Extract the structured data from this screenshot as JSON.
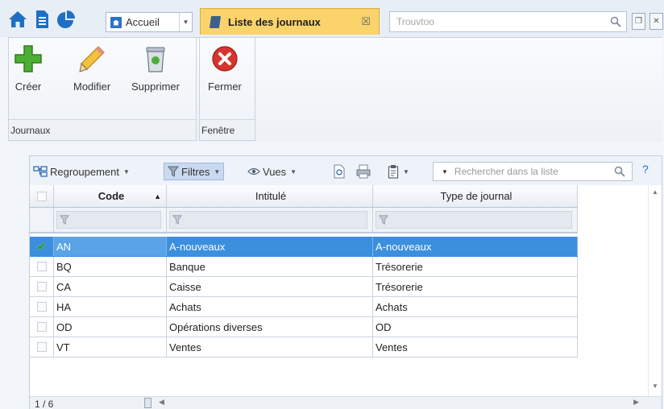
{
  "topbar": {
    "home_tab": {
      "label": "Accueil"
    },
    "active_tab": {
      "label": "Liste des journaux",
      "close_glyph": "☒"
    },
    "search": {
      "placeholder": "Trouvtoo"
    }
  },
  "ribbon": {
    "groups": [
      {
        "label": "Journaux",
        "buttons": [
          {
            "label": "Créer",
            "icon": "add-icon"
          },
          {
            "label": "Modifier",
            "icon": "pencil-icon"
          },
          {
            "label": "Supprimer",
            "icon": "trash-icon"
          }
        ]
      },
      {
        "label": "Fenêtre",
        "buttons": [
          {
            "label": "Fermer",
            "icon": "close-icon"
          }
        ]
      }
    ]
  },
  "list_toolbar": {
    "grouping_label": "Regroupement",
    "filters_label": "Filtres",
    "views_label": "Vues",
    "search_placeholder": "Rechercher dans la liste",
    "help_label": "?"
  },
  "grid": {
    "columns": [
      "Code",
      "Intitulé",
      "Type de journal"
    ],
    "rows": [
      {
        "code": "AN",
        "intitule": "A-nouveaux",
        "type": "A-nouveaux",
        "selected": true
      },
      {
        "code": "BQ",
        "intitule": "Banque",
        "type": "Trésorerie",
        "selected": false
      },
      {
        "code": "CA",
        "intitule": "Caisse",
        "type": "Trésorerie",
        "selected": false
      },
      {
        "code": "HA",
        "intitule": "Achats",
        "type": "Achats",
        "selected": false
      },
      {
        "code": "OD",
        "intitule": "Opérations diverses",
        "type": "OD",
        "selected": false
      },
      {
        "code": "VT",
        "intitule": "Ventes",
        "type": "Ventes",
        "selected": false
      }
    ],
    "pager": "1 / 6"
  },
  "colors": {
    "accent": "#fad36b",
    "selection": "#3b8fdd",
    "check": "#2f9a2b"
  }
}
